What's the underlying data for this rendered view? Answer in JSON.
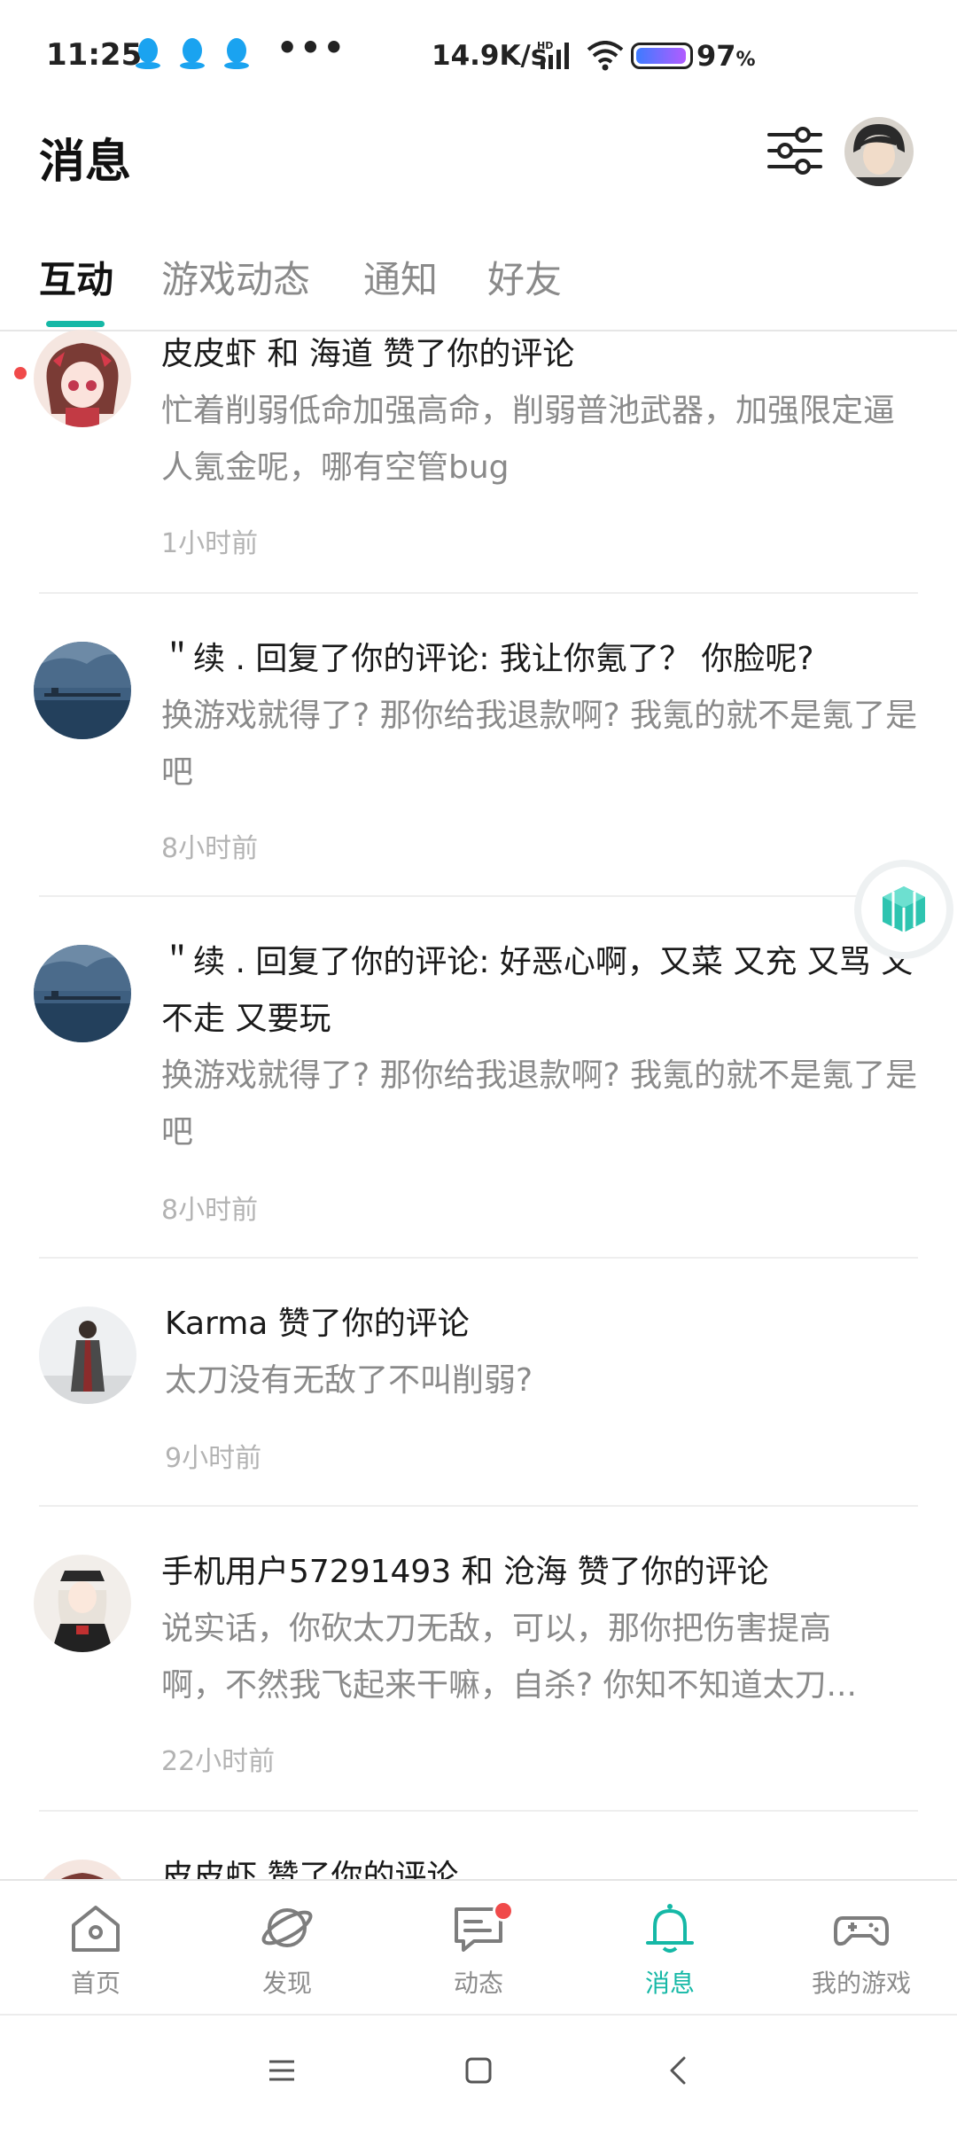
{
  "status_bar": {
    "time": "11:25",
    "more": "•••",
    "net_speed": "14.9K/s",
    "battery_pct": "97",
    "battery_unit": "%",
    "battery_level": 0.97,
    "icons": [
      "qq-icon",
      "qq-icon",
      "qq-icon",
      "signal-hd-icon",
      "wifi-icon",
      "battery-icon"
    ]
  },
  "header": {
    "title": "消息"
  },
  "tabs": [
    {
      "label": "互动",
      "active": true
    },
    {
      "label": "游戏动态",
      "active": false
    },
    {
      "label": "通知",
      "active": false
    },
    {
      "label": "好友",
      "active": false
    }
  ],
  "messages": [
    {
      "title": "皮皮虾 和 海道 赞了你的评论",
      "body": "忙着削弱低命加强高命，削弱普池武器，加强限定逼人氪金呢，哪有空管bug",
      "time": "1小时前",
      "unread": true
    },
    {
      "title": "＂续 . 回复了你的评论: 我让你氪了？ 你脸呢?",
      "body": "换游戏就得了? 那你给我退款啊? 我氪的就不是氪了是吧",
      "time": "8小时前",
      "unread": false
    },
    {
      "title": "＂续 . 回复了你的评论: 好恶心啊，又菜 又充 又骂 又不走 又要玩",
      "body": "换游戏就得了? 那你给我退款啊? 我氪的就不是氪了是吧",
      "time": "8小时前",
      "unread": false
    },
    {
      "title": "Karma 赞了你的评论",
      "body": "太刀没有无敌了不叫削弱?",
      "time": "9小时前",
      "unread": false
    },
    {
      "title": "手机用户57291493 和 沧海 赞了你的评论",
      "body": "说实话，你砍太刀无敌，可以，那你把伤害提高啊，不然我飞起来干嘛，自杀? 你知不知道太刀...",
      "time": "22小时前",
      "unread": false
    },
    {
      "title": "皮皮虾 赞了你的评论",
      "body": "",
      "time": "",
      "unread": false
    }
  ],
  "bottom_nav": [
    {
      "label": "首页",
      "icon": "home-icon",
      "active": false,
      "badge": false
    },
    {
      "label": "发现",
      "icon": "planet-icon",
      "active": false,
      "badge": false
    },
    {
      "label": "动态",
      "icon": "chat-icon",
      "active": false,
      "badge": true
    },
    {
      "label": "消息",
      "icon": "bell-icon",
      "active": true,
      "badge": false
    },
    {
      "label": "我的游戏",
      "icon": "gamepad-icon",
      "active": false,
      "badge": false
    }
  ],
  "colors": {
    "accent": "#15b8a6",
    "badge": "#f04a4a",
    "secondary_text": "#8a8a8a",
    "time_text": "#b3b3b3"
  }
}
